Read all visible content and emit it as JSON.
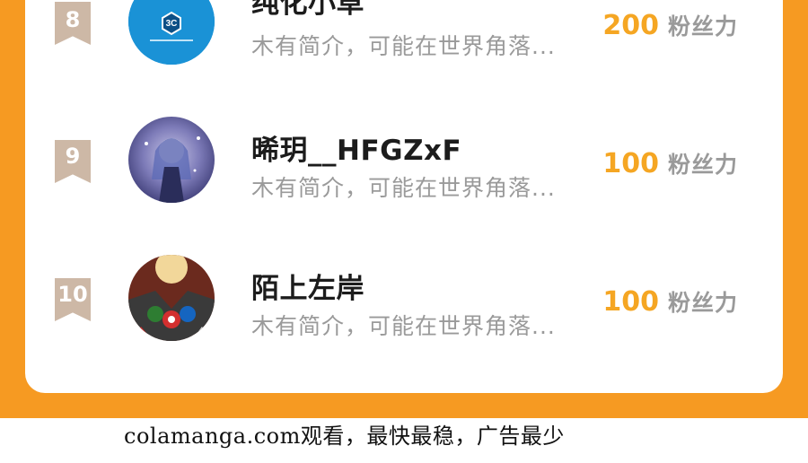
{
  "colors": {
    "panel_background": "#f69a22",
    "card_background": "#ffffff",
    "rank_badge": "#cdb8a6",
    "score_number": "#f5a623",
    "secondary_text": "#9a9a9a"
  },
  "ranking": {
    "rows": [
      {
        "rank": "8",
        "name": "纯化小草",
        "description": "木有简介，可能在世界角落...",
        "score": "200",
        "score_unit": "粉丝力",
        "avatar_icon": "3c-logo-avatar",
        "avatar_text": "3C"
      },
      {
        "rank": "9",
        "name": "晞玥__HFGZxF",
        "description": "木有简介，可能在世界角落...",
        "score": "100",
        "score_unit": "粉丝力",
        "avatar_icon": "anime-girl-avatar"
      },
      {
        "rank": "10",
        "name": "陌上左岸",
        "description": "木有简介，可能在世界角落...",
        "score": "100",
        "score_unit": "粉丝力",
        "avatar_icon": "anime-group-avatar"
      }
    ]
  },
  "footer": {
    "watermark": "colamanga.com观看，最快最稳，广告最少"
  }
}
